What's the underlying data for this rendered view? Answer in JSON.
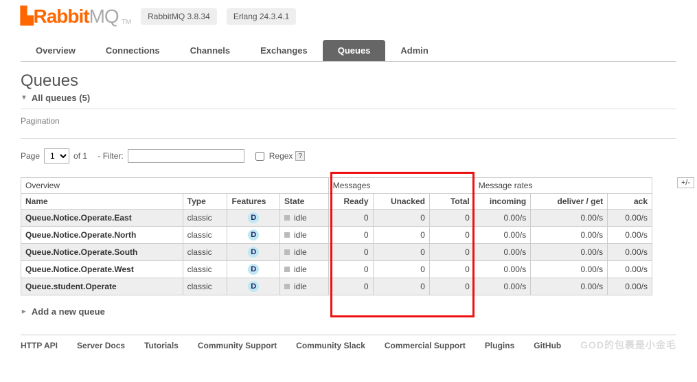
{
  "app": {
    "logo_r": "Rabbit",
    "logo_mq": "MQ",
    "tm": "TM",
    "version": "RabbitMQ 3.8.34",
    "erlang": "Erlang 24.3.4.1"
  },
  "nav": {
    "items": [
      "Overview",
      "Connections",
      "Channels",
      "Exchanges",
      "Queues",
      "Admin"
    ],
    "active": 4
  },
  "page": {
    "title": "Queues",
    "all_queues": "All queues (5)",
    "pagination_label": "Pagination",
    "page_label": "Page",
    "page_value": "1",
    "of_label": "of 1",
    "filter_label": "- Filter:",
    "regex_label": "Regex",
    "help": "?",
    "plusminus": "+/-",
    "add_new": "Add a new queue"
  },
  "table": {
    "groups": [
      "Overview",
      "Messages",
      "Message rates"
    ],
    "cols": {
      "name": "Name",
      "type": "Type",
      "features": "Features",
      "state": "State",
      "ready": "Ready",
      "unacked": "Unacked",
      "total": "Total",
      "incoming": "incoming",
      "deliver": "deliver / get",
      "ack": "ack"
    },
    "feature_badge": "D",
    "state_label": "idle",
    "rows": [
      {
        "name": "Queue.Notice.Operate.East",
        "type": "classic",
        "ready": "0",
        "unacked": "0",
        "total": "0",
        "incoming": "0.00/s",
        "deliver": "0.00/s",
        "ack": "0.00/s"
      },
      {
        "name": "Queue.Notice.Operate.North",
        "type": "classic",
        "ready": "0",
        "unacked": "0",
        "total": "0",
        "incoming": "0.00/s",
        "deliver": "0.00/s",
        "ack": "0.00/s"
      },
      {
        "name": "Queue.Notice.Operate.South",
        "type": "classic",
        "ready": "0",
        "unacked": "0",
        "total": "0",
        "incoming": "0.00/s",
        "deliver": "0.00/s",
        "ack": "0.00/s"
      },
      {
        "name": "Queue.Notice.Operate.West",
        "type": "classic",
        "ready": "0",
        "unacked": "0",
        "total": "0",
        "incoming": "0.00/s",
        "deliver": "0.00/s",
        "ack": "0.00/s"
      },
      {
        "name": "Queue.student.Operate",
        "type": "classic",
        "ready": "0",
        "unacked": "0",
        "total": "0",
        "incoming": "0.00/s",
        "deliver": "0.00/s",
        "ack": "0.00/s"
      }
    ]
  },
  "footer": {
    "links": [
      "HTTP API",
      "Server Docs",
      "Tutorials",
      "Community Support",
      "Community Slack",
      "Commercial Support",
      "Plugins",
      "GitHub"
    ],
    "watermark": "GOD的包裹是小金毛"
  }
}
